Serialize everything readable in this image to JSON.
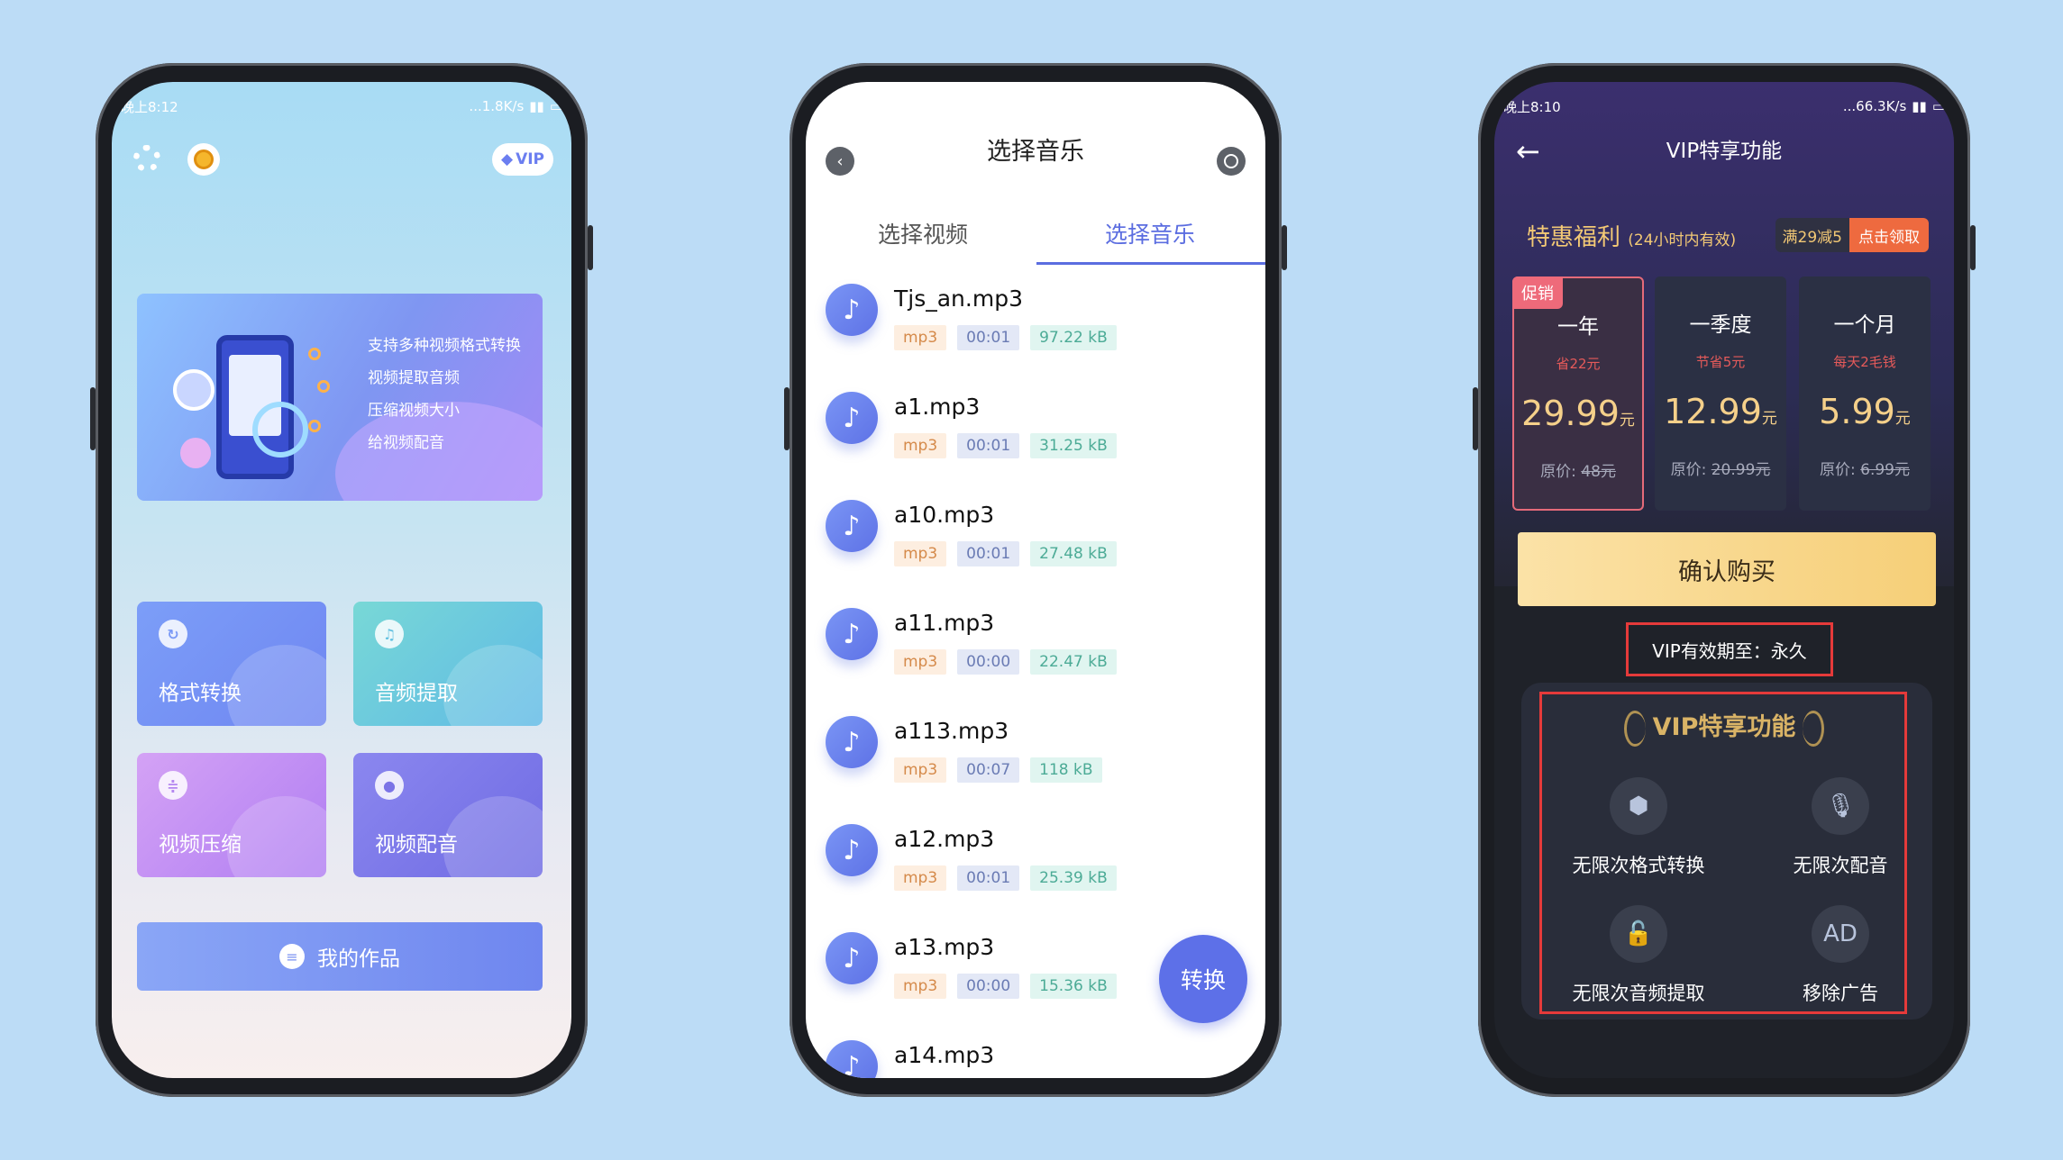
{
  "phone1": {
    "status_time": "晚上8:12",
    "status_right": "...1.8K/s",
    "vip_label": "VIP",
    "banner_lines": [
      "支持多种视频格式转换",
      "视频提取音频",
      "压缩视频大小",
      "给视频配音"
    ],
    "tiles": [
      {
        "label": "格式转换",
        "icon": "convert-icon"
      },
      {
        "label": "音频提取",
        "icon": "extract-icon"
      },
      {
        "label": "视频压缩",
        "icon": "compress-icon"
      },
      {
        "label": "视频配音",
        "icon": "mic-icon"
      }
    ],
    "works_label": "我的作品"
  },
  "phone2": {
    "title": "选择音乐",
    "tabs": [
      "选择视频",
      "选择音乐"
    ],
    "active_tab": 1,
    "files": [
      {
        "name": "Tjs_an.mp3",
        "type": "mp3",
        "duration": "00:01",
        "size": "97.22 kB"
      },
      {
        "name": "a1.mp3",
        "type": "mp3",
        "duration": "00:01",
        "size": "31.25 kB"
      },
      {
        "name": "a10.mp3",
        "type": "mp3",
        "duration": "00:01",
        "size": "27.48 kB"
      },
      {
        "name": "a11.mp3",
        "type": "mp3",
        "duration": "00:00",
        "size": "22.47 kB"
      },
      {
        "name": "a113.mp3",
        "type": "mp3",
        "duration": "00:07",
        "size": "118 kB"
      },
      {
        "name": "a12.mp3",
        "type": "mp3",
        "duration": "00:01",
        "size": "25.39 kB"
      },
      {
        "name": "a13.mp3",
        "type": "mp3",
        "duration": "00:00",
        "size": "15.36 kB"
      },
      {
        "name": "a14.mp3",
        "type": "",
        "duration": "",
        "size": ""
      }
    ],
    "fab_label": "转换"
  },
  "phone3": {
    "status_time": "晚上8:10",
    "status_right": "...66.3K/s",
    "title": "VIP特享功能",
    "offer_title": "特惠福利",
    "offer_sub": "(24小时内有效)",
    "coupon_left": "满29减5",
    "coupon_right": "点击领取",
    "plans": [
      {
        "name": "一年",
        "save": "省22元",
        "price": "29.99",
        "unit": "元",
        "orig_label": "原价:",
        "orig": "48元",
        "promo": "促销"
      },
      {
        "name": "一季度",
        "save": "节省5元",
        "price": "12.99",
        "unit": "元",
        "orig_label": "原价:",
        "orig": "20.99元"
      },
      {
        "name": "一个月",
        "save": "每天2毛钱",
        "price": "5.99",
        "unit": "元",
        "orig_label": "原价:",
        "orig": "6.99元"
      }
    ],
    "buy_label": "确认购买",
    "validity": "VIP有效期至：永久",
    "features_title": "VIP特享功能",
    "features": [
      {
        "label": "无限次格式转换",
        "icon": "cube-icon"
      },
      {
        "label": "无限次配音",
        "icon": "mic-icon"
      },
      {
        "label": "无限次音频提取",
        "icon": "lock-icon"
      },
      {
        "label": "移除广告",
        "icon": "ad-icon"
      }
    ]
  }
}
